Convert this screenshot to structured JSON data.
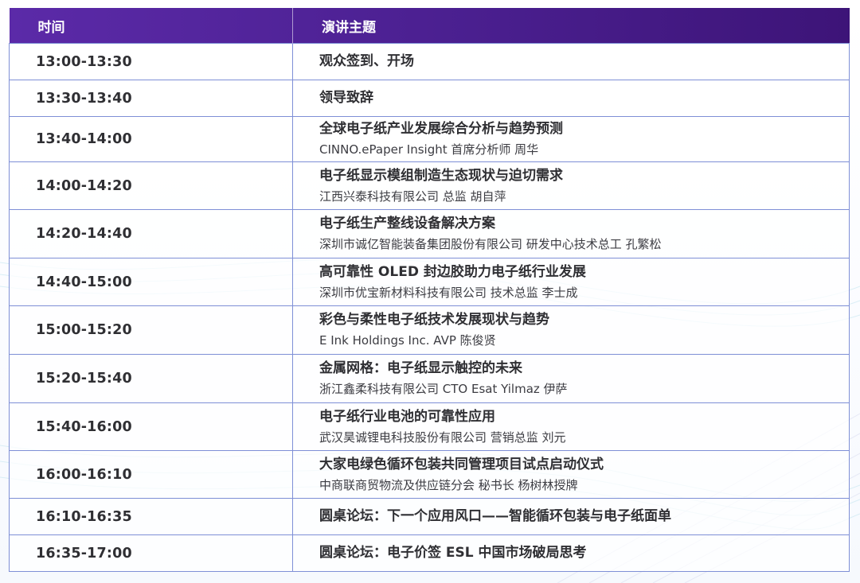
{
  "header": {
    "time_label": "时间",
    "topic_label": "演讲主题"
  },
  "rows": [
    {
      "time": "13:00-13:30",
      "title": "观众签到、开场",
      "speaker": ""
    },
    {
      "time": "13:30-13:40",
      "title": "领导致辞",
      "speaker": ""
    },
    {
      "time": "13:40-14:00",
      "title": "全球电子纸产业发展综合分析与趋势预测",
      "speaker": "CINNO.ePaper Insight 首席分析师 周华"
    },
    {
      "time": "14:00-14:20",
      "title": "电子纸显示模组制造生态现状与迫切需求",
      "speaker": "江西兴泰科技有限公司 总监 胡自萍"
    },
    {
      "time": "14:20-14:40",
      "title": "电子纸生产整线设备解决方案",
      "speaker": "深圳市诚亿智能装备集团股份有限公司 研发中心技术总工 孔繁松"
    },
    {
      "time": "14:40-15:00",
      "title": "高可靠性 OLED 封边胶助力电子纸行业发展",
      "speaker": "深圳市优宝新材料科技有限公司 技术总监 李士成"
    },
    {
      "time": "15:00-15:20",
      "title": "彩色与柔性电子纸技术发展现状与趋势",
      "speaker": "E Ink Holdings Inc. AVP 陈俊贤"
    },
    {
      "time": "15:20-15:40",
      "title": "金属网格：电子纸显示触控的未来",
      "speaker": "浙江鑫柔科技有限公司 CTO Esat Yilmaz 伊萨"
    },
    {
      "time": "15:40-16:00",
      "title": "电子纸行业电池的可靠性应用",
      "speaker": "武汉昊诚锂电科技股份有限公司 营销总监 刘元"
    },
    {
      "time": "16:00-16:10",
      "title": "大家电绿色循环包装共同管理项目试点启动仪式",
      "speaker": "中商联商贸物流及供应链分会 秘书长 杨树林授牌"
    },
    {
      "time": "16:10-16:35",
      "title": "圆桌论坛：下一个应用风口——智能循环包装与电子纸面单",
      "speaker": ""
    },
    {
      "time": "16:35-17:00",
      "title": "圆桌论坛：电子价签 ESL 中国市场破局思考",
      "speaker": ""
    }
  ],
  "colors": {
    "header_start": "#5b2aa8",
    "header_end": "#3d1478",
    "border": "#7e8fd6",
    "text": "#2f2f33"
  }
}
